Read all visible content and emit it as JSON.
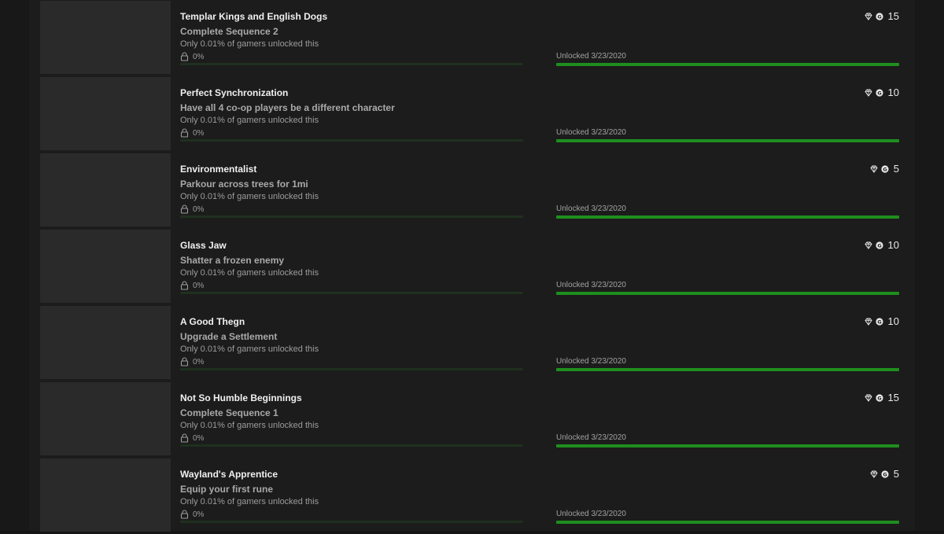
{
  "achievements": [
    {
      "title": "Templar Kings and English Dogs",
      "description": "Complete Sequence 2",
      "rarity": "Only 0.01% of gamers unlocked this",
      "percent_label": "0%",
      "unlocked": "Unlocked 3/23/2020",
      "gamerscore": "15",
      "progress_fraction": 0,
      "unlock_fraction": 1
    },
    {
      "title": "Perfect Synchronization",
      "description": "Have all 4 co-op players be a different character",
      "rarity": "Only 0.01% of gamers unlocked this",
      "percent_label": "0%",
      "unlocked": "Unlocked 3/23/2020",
      "gamerscore": "10",
      "progress_fraction": 0,
      "unlock_fraction": 1
    },
    {
      "title": "Environmentalist",
      "description": "Parkour across trees for 1mi",
      "rarity": "Only 0.01% of gamers unlocked this",
      "percent_label": "0%",
      "unlocked": "Unlocked 3/23/2020",
      "gamerscore": "5",
      "progress_fraction": 0,
      "unlock_fraction": 1
    },
    {
      "title": "Glass Jaw",
      "description": "Shatter a frozen enemy",
      "rarity": "Only 0.01% of gamers unlocked this",
      "percent_label": "0%",
      "unlocked": "Unlocked 3/23/2020",
      "gamerscore": "10",
      "progress_fraction": 0,
      "unlock_fraction": 1
    },
    {
      "title": "A Good Thegn",
      "description": "Upgrade a Settlement",
      "rarity": "Only 0.01% of gamers unlocked this",
      "percent_label": "0%",
      "unlocked": "Unlocked 3/23/2020",
      "gamerscore": "10",
      "progress_fraction": 0,
      "unlock_fraction": 1
    },
    {
      "title": "Not So Humble Beginnings",
      "description": "Complete Sequence 1",
      "rarity": "Only 0.01% of gamers unlocked this",
      "percent_label": "0%",
      "unlocked": "Unlocked 3/23/2020",
      "gamerscore": "15",
      "progress_fraction": 0,
      "unlock_fraction": 1
    },
    {
      "title": "Wayland's Apprentice",
      "description": "Equip your first rune",
      "rarity": "Only 0.01% of gamers unlocked this",
      "percent_label": "0%",
      "unlocked": "Unlocked 3/23/2020",
      "gamerscore": "5",
      "progress_fraction": 0,
      "unlock_fraction": 1
    }
  ],
  "icons": {
    "rarity": "diamond-icon",
    "gamerscore": "gamerscore-g-icon",
    "lock": "lock-icon"
  },
  "colors": {
    "progress_green": "#1e8f1e",
    "track_dark_green": "#1f301f",
    "background": "#1c1c1c"
  }
}
